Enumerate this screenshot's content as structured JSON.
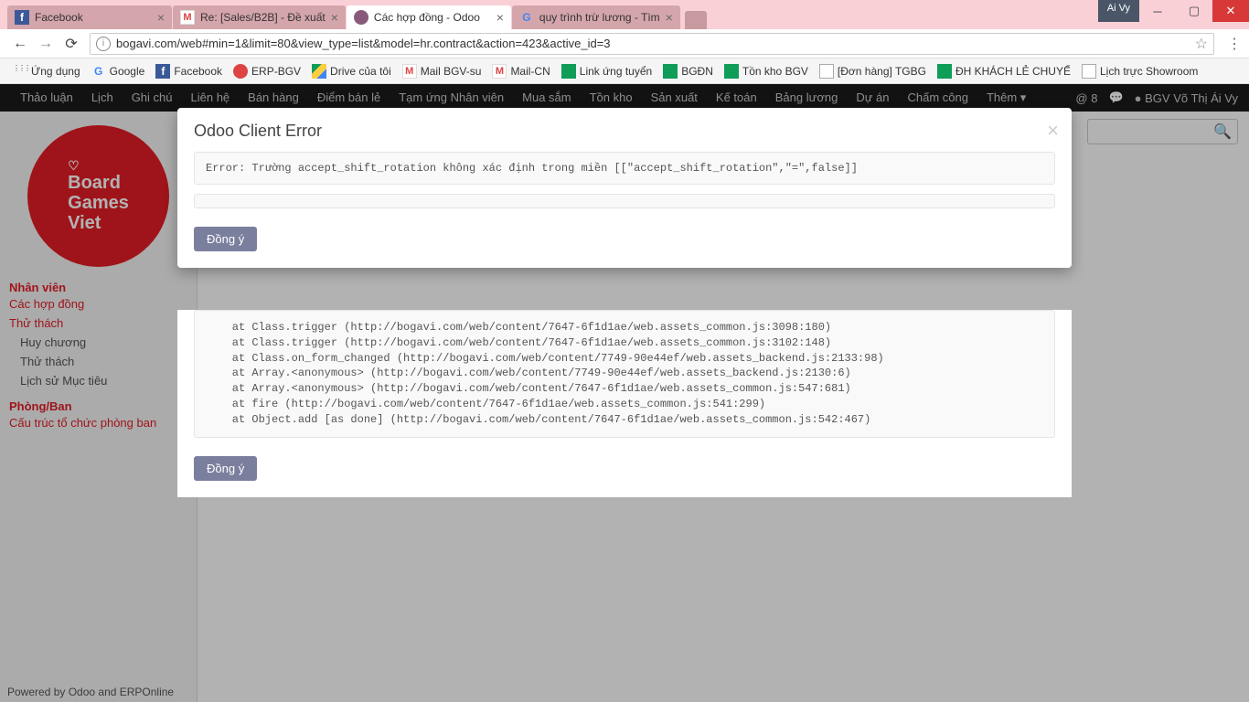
{
  "chrome": {
    "tabs": [
      {
        "title": "Facebook",
        "icon": "fb"
      },
      {
        "title": "Re: [Sales/B2B] - Đề xuất",
        "icon": "gm"
      },
      {
        "title": "Các hợp đồng - Odoo",
        "icon": "odoo",
        "active": true
      },
      {
        "title": "quy trình trừ lương - Tìm",
        "icon": "g"
      }
    ],
    "user": "Ai Vy",
    "url": "bogavi.com/web#min=1&limit=80&view_type=list&model=hr.contract&action=423&active_id=3"
  },
  "bookmarks": [
    {
      "label": "Ứng dụng",
      "icon": "apps"
    },
    {
      "label": "Google",
      "icon": "g"
    },
    {
      "label": "Facebook",
      "icon": "fb"
    },
    {
      "label": "ERP-BGV",
      "icon": "erp"
    },
    {
      "label": "Drive của tôi",
      "icon": "drive"
    },
    {
      "label": "Mail BGV-su",
      "icon": "gm"
    },
    {
      "label": "Mail-CN",
      "icon": "gm"
    },
    {
      "label": "Link ứng tuyển",
      "icon": "sheet"
    },
    {
      "label": "BGĐN",
      "icon": "sheet"
    },
    {
      "label": "Tồn kho BGV",
      "icon": "sheet"
    },
    {
      "label": "[Đơn hàng] TGBG",
      "icon": "doc"
    },
    {
      "label": "ĐH KHÁCH LẺ CHUYỂ",
      "icon": "sheet"
    },
    {
      "label": "Lịch trực Showroom",
      "icon": "doc"
    }
  ],
  "odoo_nav": {
    "items": [
      "Thảo luận",
      "Lịch",
      "Ghi chú",
      "Liên hệ",
      "Bán hàng",
      "Điểm bán lẻ",
      "Tạm ứng Nhân viên",
      "Mua sắm",
      "Tồn kho",
      "Sản xuất",
      "Kế toán",
      "Bảng lương",
      "Dự án",
      "Chấm công",
      "Thêm ▾"
    ],
    "msg_count": "8",
    "user": "BGV Võ Thị Ái Vy"
  },
  "sidebar": {
    "group1": "Nhân viên",
    "link_contracts": "Các hợp đồng",
    "link_challenges": "Thử thách",
    "sub_medals": "Huy chương",
    "sub_challenges": "Thử thách",
    "sub_history": "Lịch sử Mục tiêu",
    "group2": "Phòng/Ban",
    "link_structure": "Cấu trúc tổ chức phòng ban"
  },
  "modal": {
    "title": "Odoo Client Error",
    "error_text": "Error: Trường accept_shift_rotation không xác định trong miền [[\"accept_shift_rotation\",\"=\",false]]",
    "btn": "Đồng ý",
    "trace": "    at Class.trigger (http://bogavi.com/web/content/7647-6f1d1ae/web.assets_common.js:3098:180)\n    at Class.trigger (http://bogavi.com/web/content/7647-6f1d1ae/web.assets_common.js:3102:148)\n    at Class.on_form_changed (http://bogavi.com/web/content/7749-90e44ef/web.assets_backend.js:2133:98)\n    at Array.<anonymous> (http://bogavi.com/web/content/7749-90e44ef/web.assets_backend.js:2130:6)\n    at Array.<anonymous> (http://bogavi.com/web/content/7647-6f1d1ae/web.assets_common.js:547:681)\n    at fire (http://bogavi.com/web/content/7647-6f1d1ae/web.assets_common.js:541:299)\n    at Object.add [as done] (http://bogavi.com/web/content/7647-6f1d1ae/web.assets_common.js:542:467)"
  },
  "footer": "Powered by Odoo and ERPOnline",
  "logo": {
    "l1": "Board",
    "l2": "Games",
    "l3": "Viet"
  }
}
